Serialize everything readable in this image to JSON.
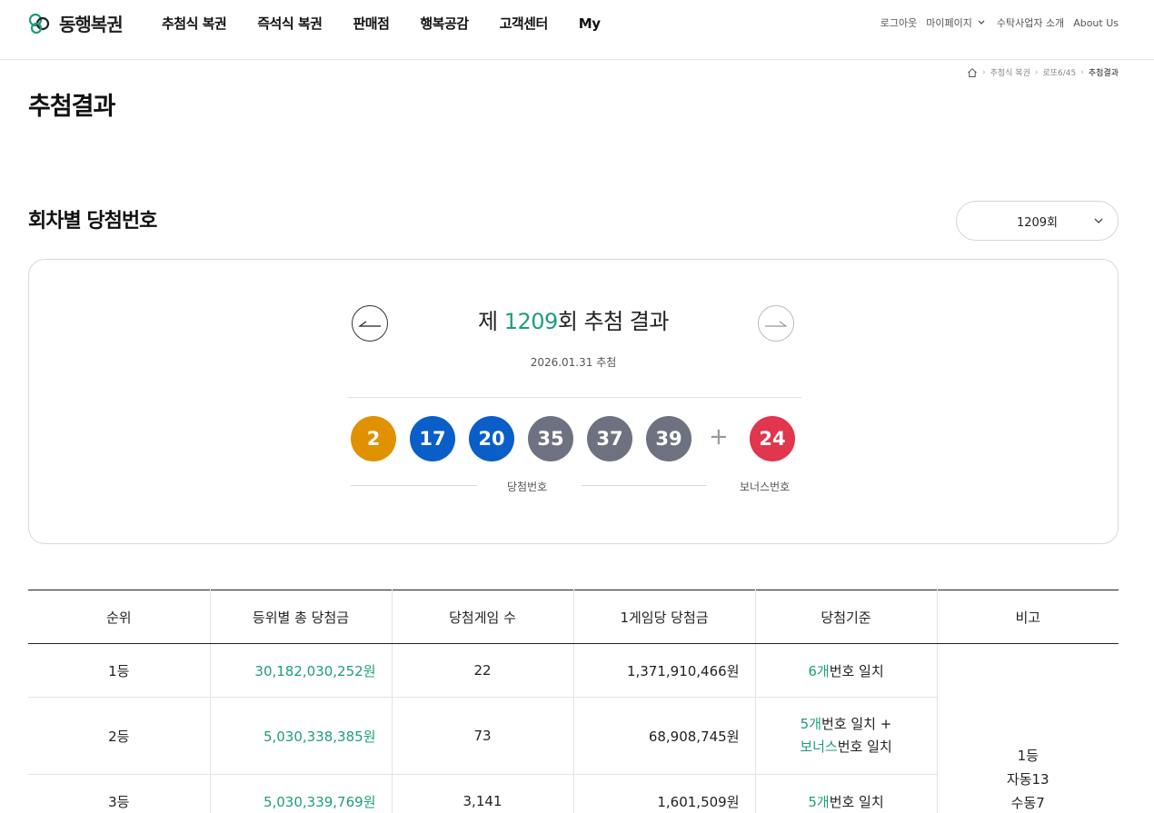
{
  "header": {
    "logo_text": "동행복권",
    "nav": [
      "추첨식 복권",
      "즉석식 복권",
      "판매점",
      "행복공감",
      "고객센터",
      "My"
    ],
    "util": {
      "logout": "로그아웃",
      "mypage": "마이페이지",
      "trustee": "수탁사업자 소개",
      "about": "About Us"
    }
  },
  "breadcrumb": {
    "items": [
      "추첨식 복권",
      "로또6/45"
    ],
    "current": "추첨결과"
  },
  "page_title": "추첨결과",
  "section": {
    "title": "회차별 당첨번호",
    "select_value": "1209회"
  },
  "draw": {
    "title_prefix": "제 ",
    "round": "1209",
    "title_suffix": "회 추첨 결과",
    "date": "2026.01.31 추첨",
    "balls": [
      {
        "num": "2",
        "color": "#e09100"
      },
      {
        "num": "17",
        "color": "#0a5ec7"
      },
      {
        "num": "20",
        "color": "#0a5ec7"
      },
      {
        "num": "35",
        "color": "#6e7280"
      },
      {
        "num": "37",
        "color": "#6e7280"
      },
      {
        "num": "39",
        "color": "#6e7280"
      }
    ],
    "plus": "+",
    "bonus": {
      "num": "24",
      "color": "#e0364e"
    },
    "win_label": "당첨번호",
    "bonus_label": "보너스번호"
  },
  "table": {
    "headers": [
      "순위",
      "등위별 총 당첨금",
      "당첨게임 수",
      "1게임당 당첨금",
      "당첨기준",
      "비고"
    ],
    "rows": [
      {
        "rank": "1등",
        "total": "30,182,030,252원",
        "games": "22",
        "per_game": "1,371,910,466원",
        "crit_num": "6개",
        "crit_text": "번호 일치"
      },
      {
        "rank": "2등",
        "total": "5,030,338,385원",
        "games": "73",
        "per_game": "68,908,745원",
        "crit_num": "5개",
        "crit_text": "번호 일치 +",
        "crit_num2": "보너스",
        "crit_text2": "번호 일치"
      },
      {
        "rank": "3등",
        "total": "5,030,339,769원",
        "games": "3,141",
        "per_game": "1,601,509원",
        "crit_num": "5개",
        "crit_text": "번호 일치"
      }
    ],
    "note": [
      "1등",
      "자동13",
      "수동7"
    ]
  },
  "colors": {
    "accent": "#1e9c7e"
  }
}
